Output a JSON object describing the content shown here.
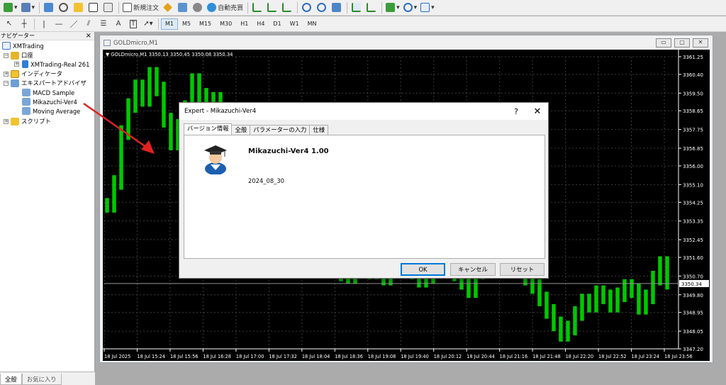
{
  "toolbar1": {
    "new_order_label": "新規注文",
    "autotrade_label": "自動売買"
  },
  "toolbar2": {
    "timeframes": [
      "M1",
      "M5",
      "M15",
      "M30",
      "H1",
      "H4",
      "D1",
      "W1",
      "MN"
    ],
    "active_timeframe": "M1"
  },
  "navigator": {
    "title": "ナビゲーター",
    "close_glyph": "×",
    "root": "XMTrading",
    "accounts": "口座",
    "account_item": "XMTrading-Real 261",
    "indicators": "インディケータ",
    "experts": "エキスパートアドバイザ",
    "expert_items": [
      "MACD Sample",
      "Mikazuchi-Ver4",
      "Moving Average"
    ],
    "scripts": "スクリプト",
    "tabs": [
      "全般",
      "お気に入り"
    ]
  },
  "chart_window": {
    "title": "GOLDmicro,M1",
    "header": "▼ GOLDmicro,M1  3350.13 3350.45 3350.08 3350.34",
    "win_buttons": [
      "▭",
      "▢",
      "✕"
    ]
  },
  "chart_data": {
    "type": "line",
    "symbol": "GOLDmicro",
    "timeframe": "M1",
    "ohlc_header": [
      3350.13,
      3350.45,
      3350.08,
      3350.34
    ],
    "current_price": 3350.34,
    "y_ticks": [
      "3361.25",
      "3360.40",
      "3359.50",
      "3358.65",
      "3357.75",
      "3356.85",
      "3356.00",
      "3355.10",
      "3354.25",
      "3353.35",
      "3352.45",
      "3351.60",
      "3350.70",
      "3349.80",
      "3348.95",
      "3348.05",
      "3347.20"
    ],
    "ylim": [
      3347.2,
      3361.25
    ],
    "x_ticks": [
      "18 Jul 2025",
      "18 Jul 15:24",
      "18 Jul 15:56",
      "18 Jul 16:28",
      "18 Jul 17:00",
      "18 Jul 17:32",
      "18 Jul 18:04",
      "18 Jul 18:36",
      "18 Jul 19:08",
      "18 Jul 19:40",
      "18 Jul 20:12",
      "18 Jul 20:44",
      "18 Jul 21:16",
      "18 Jul 21:48",
      "18 Jul 22:20",
      "18 Jul 22:52",
      "18 Jul 23:24",
      "18 Jul 23:56"
    ],
    "series": [
      {
        "name": "GOLDmicro,M1",
        "color": "#00c800",
        "values": [
          3354.1,
          3355.2,
          3357.6,
          3358.9,
          3359.8,
          3359.2,
          3360.4,
          3359.7,
          3358.2,
          3357.1,
          3357.9,
          3358.8,
          3360.1,
          3359.4,
          3358.6,
          3359.2,
          3357.5,
          3357.9,
          3356.9,
          3357.4,
          3358.1,
          3358.3,
          3357.0,
          3356.4,
          3355.8,
          3354.9,
          3354.0,
          3353.1,
          3352.6,
          3352.1,
          3351.8,
          3351.4,
          3351.0,
          3350.8,
          3350.7,
          3351.2,
          3351.6,
          3350.9,
          3351.1,
          3350.6,
          3351.0,
          3351.4,
          3351.3,
          3350.9,
          3350.5,
          3350.7,
          3351.1,
          3351.5,
          3351.3,
          3350.8,
          3350.4,
          3350.0,
          3350.9,
          3351.5,
          3352.0,
          3352.2,
          3352.6,
          3351.9,
          3351.1,
          3350.6,
          3350.2,
          3349.6,
          3349.0,
          3348.4,
          3347.9,
          3348.2,
          3348.9,
          3349.5,
          3349.3,
          3349.9,
          3349.7,
          3349.3,
          3349.8,
          3350.2,
          3350.0,
          3349.2,
          3349.7,
          3350.6,
          3351.3,
          3350.4
        ]
      }
    ],
    "grid": true
  },
  "dialog": {
    "title": "Expert - Mikazuchi-Ver4",
    "help_glyph": "?",
    "close_glyph": "✕",
    "tabs": [
      "バージョン情報",
      "全般",
      "パラメーターの入力",
      "仕様"
    ],
    "name": "Mikazuchi-Ver4 1.00",
    "version_date": "2024_08_30",
    "ok_label": "OK",
    "cancel_label": "キャンセル",
    "reset_label": "リセット"
  },
  "colors": {
    "chart_bg": "#000000",
    "chart_line": "#00c800",
    "grid": "#3c3c3c",
    "axis_text": "#ffffff",
    "annotation_arrow": "#e0221e"
  }
}
